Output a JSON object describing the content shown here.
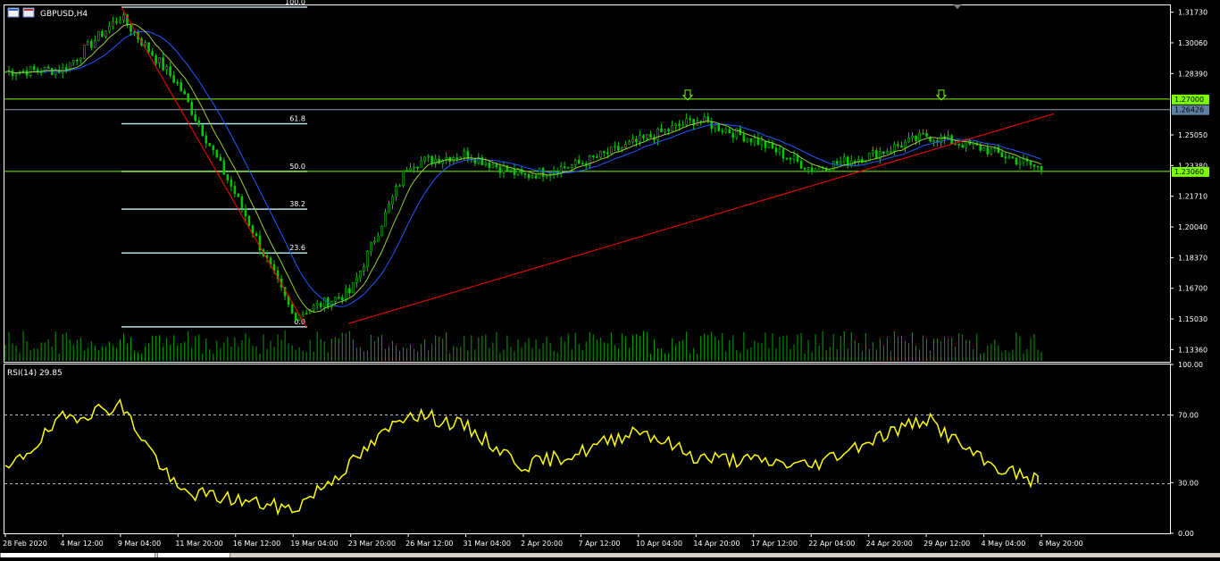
{
  "window": {
    "symbol_title": "GBPUSD,H4"
  },
  "indicator": {
    "label": "RSI(14) 29.85"
  },
  "colors": {
    "background": "#000000",
    "frame": "#ffffff",
    "candle": "#00c800",
    "ma_fast": "#9acd32",
    "ma_slow": "#1e5aff",
    "trendline": "#ff0000",
    "fibo": "#b0e0e6",
    "hline": "#7cfc00",
    "rsi": "#ffff00",
    "price_tag_green": "#7cfc00",
    "price_tag_blue": "#5f7fa0"
  },
  "price_axis": {
    "ticks": [
      "1.31730",
      "1.30060",
      "1.28390",
      "1.25050",
      "1.23380",
      "1.21710",
      "1.20040",
      "1.18370",
      "1.16700",
      "1.15030",
      "1.13360"
    ],
    "tags": [
      {
        "price": 1.27,
        "label": "1.27000",
        "color": "green"
      },
      {
        "price": 1.26426,
        "label": "1.26426",
        "color": "blue"
      },
      {
        "price": 1.2306,
        "label": "1.23060",
        "color": "green"
      }
    ]
  },
  "rsi_axis": {
    "ticks": [
      "100.00",
      "70.00",
      "30.00",
      "0.00"
    ]
  },
  "time_axis": {
    "labels": [
      "28 Feb 2020",
      "4 Mar 12:00",
      "9 Mar 04:00",
      "11 Mar 20:00",
      "16 Mar 12:00",
      "19 Mar 04:00",
      "23 Mar 20:00",
      "26 Mar 12:00",
      "31 Mar 04:00",
      "2 Apr 20:00",
      "7 Apr 12:00",
      "10 Apr 04:00",
      "14 Apr 20:00",
      "17 Apr 12:00",
      "22 Apr 04:00",
      "24 Apr 20:00",
      "29 Apr 12:00",
      "4 May 04:00",
      "6 May 20:00"
    ]
  },
  "fibonacci": {
    "levels": [
      {
        "label": "100.0",
        "price": 1.32
      },
      {
        "label": "61.8",
        "price": 1.2566
      },
      {
        "label": "50.0",
        "price": 1.2306
      },
      {
        "label": "38.2",
        "price": 1.2101
      },
      {
        "label": "23.6",
        "price": 1.1862
      },
      {
        "label": "0.0",
        "price": 1.146
      }
    ]
  },
  "chart_data": {
    "type": "candlestick",
    "symbol": "GBPUSD",
    "timeframe": "H4",
    "price_range": [
      1.127,
      1.321
    ],
    "rsi_range": [
      0,
      100
    ],
    "rsi_levels": [
      70,
      30
    ],
    "rsi_last": 29.85,
    "horizontal_lines": [
      1.27,
      1.26426,
      1.2306
    ],
    "trendline": {
      "from_price": 1.1478,
      "to_price": 1.262
    },
    "price_path": [
      {
        "t": "28 Feb 2020",
        "p": 1.285
      },
      {
        "t": "4 Mar 12:00",
        "p": 1.286
      },
      {
        "t": "9 Mar 04:00",
        "p": 1.315
      },
      {
        "t": "11 Mar 20:00",
        "p": 1.278
      },
      {
        "t": "16 Mar 12:00",
        "p": 1.218
      },
      {
        "t": "19 Mar 04:00",
        "p": 1.152
      },
      {
        "t": "23 Mar 20:00",
        "p": 1.165
      },
      {
        "t": "26 Mar 12:00",
        "p": 1.235
      },
      {
        "t": "31 Mar 04:00",
        "p": 1.24
      },
      {
        "t": "2 Apr 20:00",
        "p": 1.228
      },
      {
        "t": "7 Apr 12:00",
        "p": 1.235
      },
      {
        "t": "10 Apr 04:00",
        "p": 1.247
      },
      {
        "t": "14 Apr 20:00",
        "p": 1.259
      },
      {
        "t": "17 Apr 12:00",
        "p": 1.248
      },
      {
        "t": "22 Apr 04:00",
        "p": 1.232
      },
      {
        "t": "24 Apr 20:00",
        "p": 1.239
      },
      {
        "t": "29 Apr 12:00",
        "p": 1.25
      },
      {
        "t": "4 May 04:00",
        "p": 1.243
      },
      {
        "t": "6 May 20:00",
        "p": 1.232
      }
    ],
    "rsi_path": [
      {
        "t": "28 Feb 2020",
        "v": 36
      },
      {
        "t": "4 Mar 12:00",
        "v": 68
      },
      {
        "t": "9 Mar 04:00",
        "v": 76
      },
      {
        "t": "11 Mar 20:00",
        "v": 25
      },
      {
        "t": "16 Mar 12:00",
        "v": 20
      },
      {
        "t": "19 Mar 04:00",
        "v": 14
      },
      {
        "t": "23 Mar 20:00",
        "v": 41
      },
      {
        "t": "26 Mar 12:00",
        "v": 72
      },
      {
        "t": "31 Mar 04:00",
        "v": 63
      },
      {
        "t": "2 Apr 20:00",
        "v": 40
      },
      {
        "t": "7 Apr 12:00",
        "v": 48
      },
      {
        "t": "10 Apr 04:00",
        "v": 62
      },
      {
        "t": "14 Apr 20:00",
        "v": 45
      },
      {
        "t": "17 Apr 12:00",
        "v": 43
      },
      {
        "t": "22 Apr 04:00",
        "v": 40
      },
      {
        "t": "24 Apr 20:00",
        "v": 55
      },
      {
        "t": "29 Apr 12:00",
        "v": 68
      },
      {
        "t": "4 May 04:00",
        "v": 42
      },
      {
        "t": "6 May 20:00",
        "v": 30
      }
    ]
  }
}
